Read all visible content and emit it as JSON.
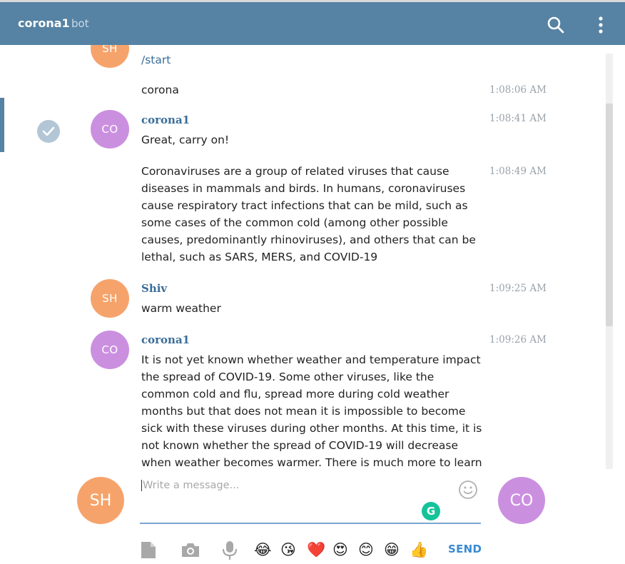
{
  "header": {
    "title": "corona1",
    "subtitle": "bot",
    "color": "#5682a3"
  },
  "messages": [
    {
      "avatar": "SH",
      "text": "/start"
    },
    {
      "text": "corona",
      "time": "1:08:06 AM"
    },
    {
      "avatar": "CO",
      "name": "corona1",
      "text": "Great, carry on!",
      "time": "1:08:41 AM"
    },
    {
      "text": "Coronaviruses are a group of related viruses that cause diseases in mammals and birds. In humans, coronaviruses cause respiratory tract infections that can be mild, such as some cases of the common cold (among other possible causes, predominantly rhinoviruses), and others that can be lethal, such as SARS, MERS, and COVID-19",
      "time": "1:08:49 AM"
    },
    {
      "avatar": "SH",
      "name": "Shiv",
      "text": "warm weather",
      "time": "1:09:25 AM"
    },
    {
      "avatar": "CO",
      "name": "corona1",
      "text": "It is not yet known whether weather and temperature impact the spread of COVID-19. Some other viruses, like the common cold and flu, spread more during cold weather months but that does not mean it is impossible to become sick with these viruses during other months.  At this time, it is not known whether the spread of COVID-19 will decrease when weather becomes warmer.  There is much more to learn about the transmissibility, severity, and",
      "time": "1:09:26 AM"
    }
  ],
  "composer": {
    "placeholder": "Write a message...",
    "self_avatar": "SH",
    "peer_avatar": "CO",
    "grammarly_label": "G",
    "send_label": "SEND"
  },
  "toolbar": {
    "icons": [
      "file-icon",
      "camera-icon",
      "microphone-icon"
    ],
    "emojis": [
      "😂",
      "😘",
      "❤️",
      "😍",
      "😊",
      "😁",
      "👍"
    ]
  },
  "colors": {
    "accent": "#5682a3",
    "link": "#3a6d99",
    "avatar_sh": "#f6a36b",
    "avatar_co": "#cb8fe0",
    "send": "#3a8ad1"
  }
}
